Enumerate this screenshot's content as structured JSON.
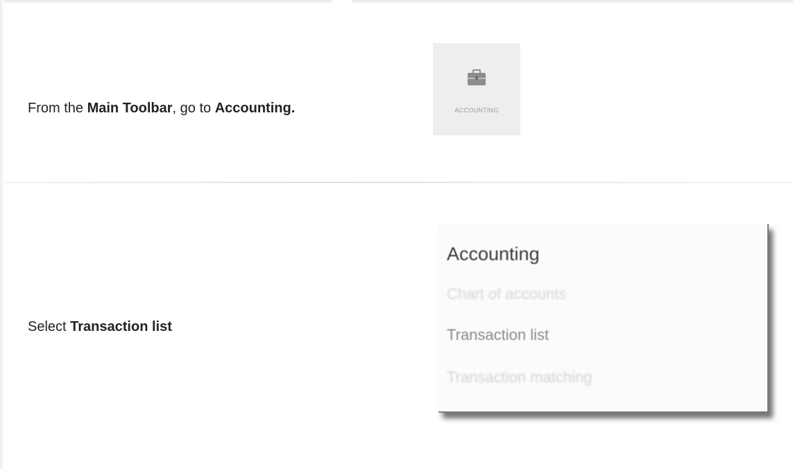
{
  "steps": [
    {
      "text_prefix": "From the ",
      "bold_1": "Main Toolbar",
      "text_middle": ", go to ",
      "bold_2": "Accounting."
    },
    {
      "text_prefix": "Select ",
      "bold_1": "Transaction list"
    }
  ],
  "toolbar_tile": {
    "label": "ACCOUNTING",
    "icon": "briefcase-icon"
  },
  "accounting_menu": {
    "title": "Accounting",
    "items": [
      "Chart of accounts",
      "Transaction list",
      "Transaction matching"
    ]
  },
  "colors": {
    "tile_background": "#eeeeee",
    "icon_color": "#8c8c8c",
    "menu_background": "#fbfbfb"
  }
}
